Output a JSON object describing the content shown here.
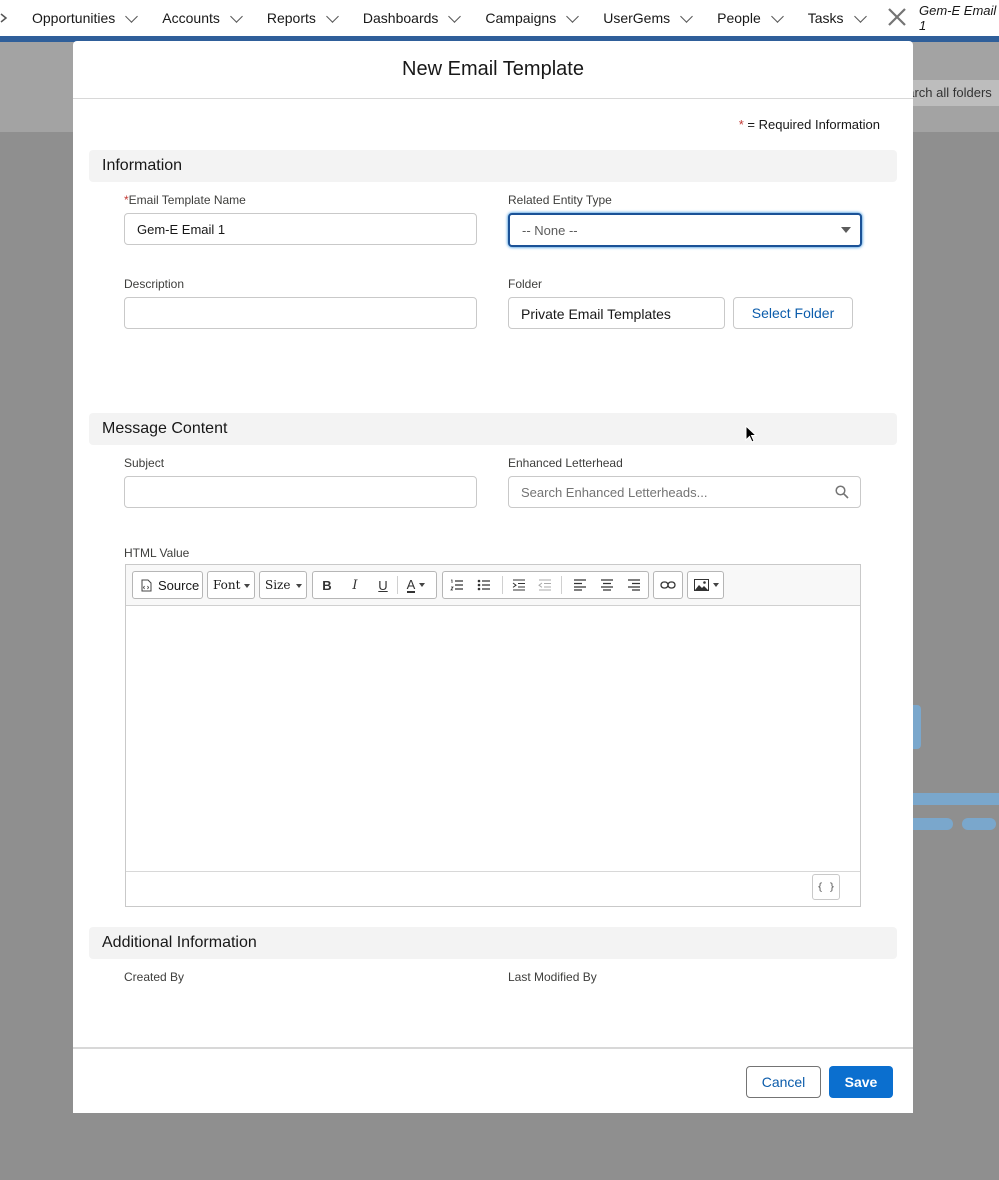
{
  "nav": {
    "items": [
      "Opportunities",
      "Accounts",
      "Reports",
      "Dashboards",
      "Campaigns",
      "UserGems",
      "People",
      "Tasks"
    ],
    "active_tab": "Gem-E Email 1",
    "search_placeholder": "earch all folders"
  },
  "modal": {
    "title": "New Email Template",
    "required_legend": "= Required Information",
    "required_star": "*"
  },
  "information": {
    "heading": "Information",
    "template_name_label": "Email Template Name",
    "template_name_value": "Gem-E Email 1",
    "entity_type_label": "Related Entity Type",
    "entity_type_value": "-- None --",
    "description_label": "Description",
    "description_value": "",
    "folder_label": "Folder",
    "folder_value": "Private Email Templates",
    "select_folder_label": "Select Folder"
  },
  "message": {
    "heading": "Message Content",
    "subject_label": "Subject",
    "subject_value": "",
    "letterhead_label": "Enhanced Letterhead",
    "letterhead_placeholder": "Search Enhanced Letterheads...",
    "html_label": "HTML Value",
    "toolbar": {
      "source_label": "Source",
      "font_label": "Font",
      "size_label": "Size",
      "bold": "B",
      "italic": "I",
      "underline": "U",
      "text_color": "A"
    },
    "merge_label": "{ }"
  },
  "additional": {
    "heading": "Additional Information",
    "created_by_label": "Created By",
    "modified_by_label": "Last Modified By"
  },
  "footer": {
    "cancel_label": "Cancel",
    "save_label": "Save"
  },
  "colors": {
    "brand": "#0b6fcf",
    "link": "#0b5cab",
    "required": "#c23934"
  }
}
